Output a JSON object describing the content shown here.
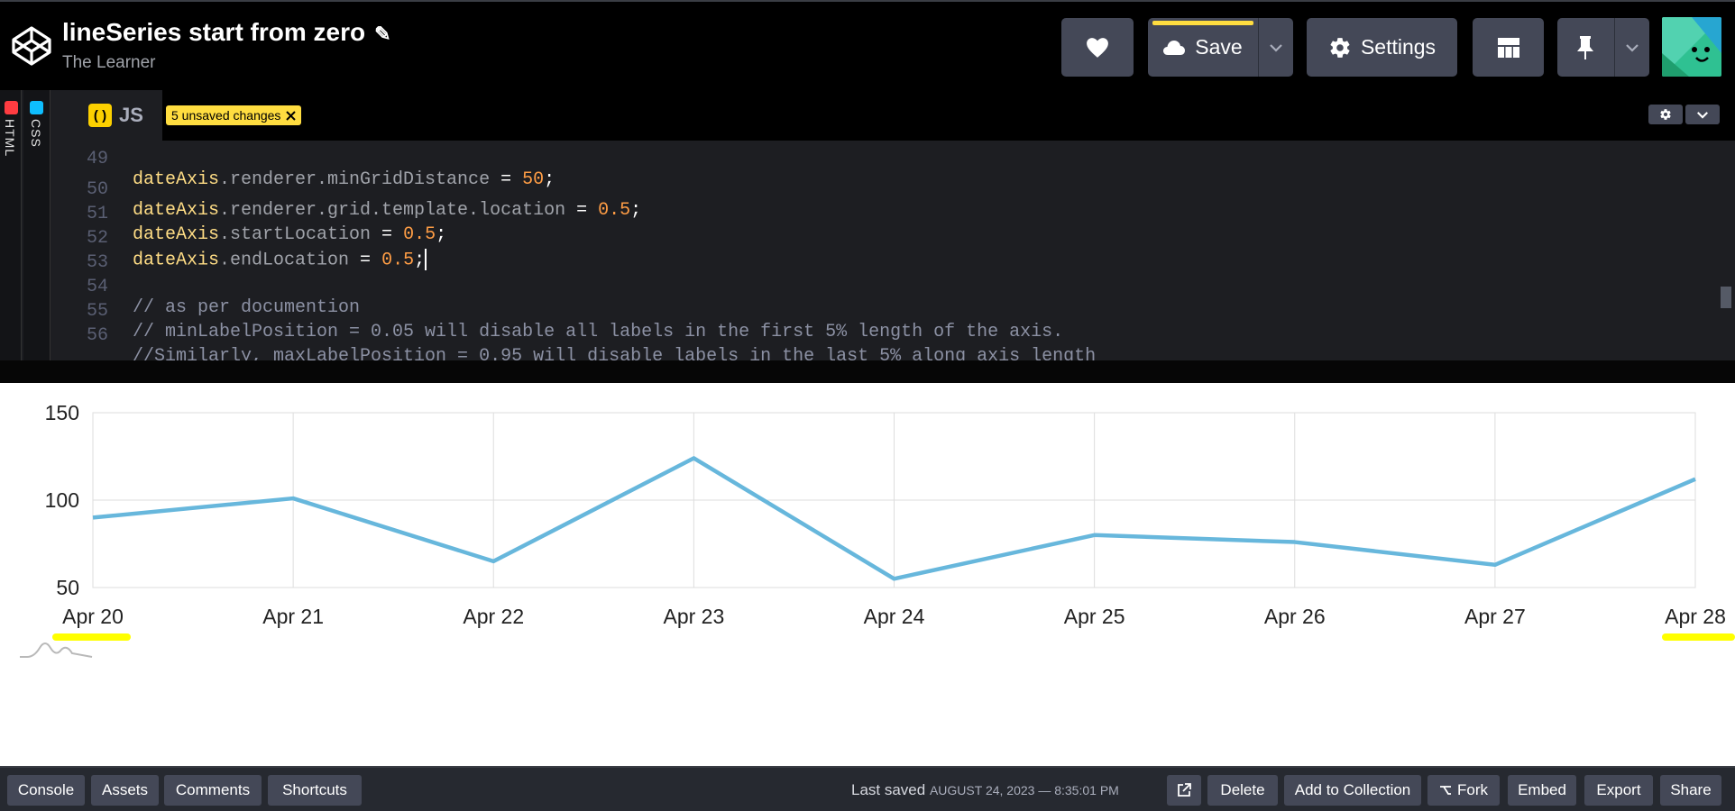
{
  "header": {
    "title": "lineSeries start from zero",
    "author": "The Learner",
    "save_label": "Save",
    "settings_label": "Settings"
  },
  "editor": {
    "side_tabs": [
      "HTML",
      "CSS"
    ],
    "active_tab": "JS",
    "unsaved_badge": "5 unsaved changes",
    "lines": [
      {
        "n": "49",
        "obj": "dateAxis",
        "rest": ".renderer.minGridDistance",
        "eq": " = ",
        "num": "50",
        "end": ";"
      },
      {
        "n": "50",
        "obj": "dateAxis",
        "rest": ".renderer.grid.template.location",
        "eq": " = ",
        "num": "0.5",
        "end": ";"
      },
      {
        "n": "51",
        "obj": "dateAxis",
        "rest": ".startLocation",
        "eq": " = ",
        "num": "0.5",
        "end": ";"
      },
      {
        "n": "52",
        "obj": "dateAxis",
        "rest": ".endLocation",
        "eq": " = ",
        "num": "0.5",
        "end": ";"
      },
      {
        "n": "53",
        "comment": ""
      },
      {
        "n": "54",
        "comment": "// as per documention"
      },
      {
        "n": "55",
        "comment": "// minLabelPosition = 0.05 will disable all labels in the first 5% length of the axis."
      },
      {
        "n": "56",
        "comment": "//Similarly, maxLabelPosition = 0.95 will disable labels in the last 5% along axis length"
      }
    ]
  },
  "chart_data": {
    "type": "line",
    "categories": [
      "Apr 20",
      "Apr 21",
      "Apr 22",
      "Apr 23",
      "Apr 24",
      "Apr 25",
      "Apr 26",
      "Apr 27",
      "Apr 28"
    ],
    "series": [
      {
        "values": [
          90,
          101,
          65,
          124,
          55,
          80,
          76,
          63,
          112
        ],
        "color": "#67b7dc"
      }
    ],
    "ylim": [
      50,
      150
    ],
    "yticks": [
      "150",
      "100",
      "50"
    ],
    "grid": true,
    "highlight_color": "#ffff00"
  },
  "footer": {
    "left_buttons": [
      "Console",
      "Assets",
      "Comments",
      "Shortcuts"
    ],
    "last_saved_label": "Last saved",
    "last_saved_time": "AUGUST 24, 2023 — 8:35:01 PM",
    "right_buttons": [
      "Delete",
      "Add to Collection",
      "Fork",
      "Embed",
      "Export",
      "Share"
    ]
  }
}
